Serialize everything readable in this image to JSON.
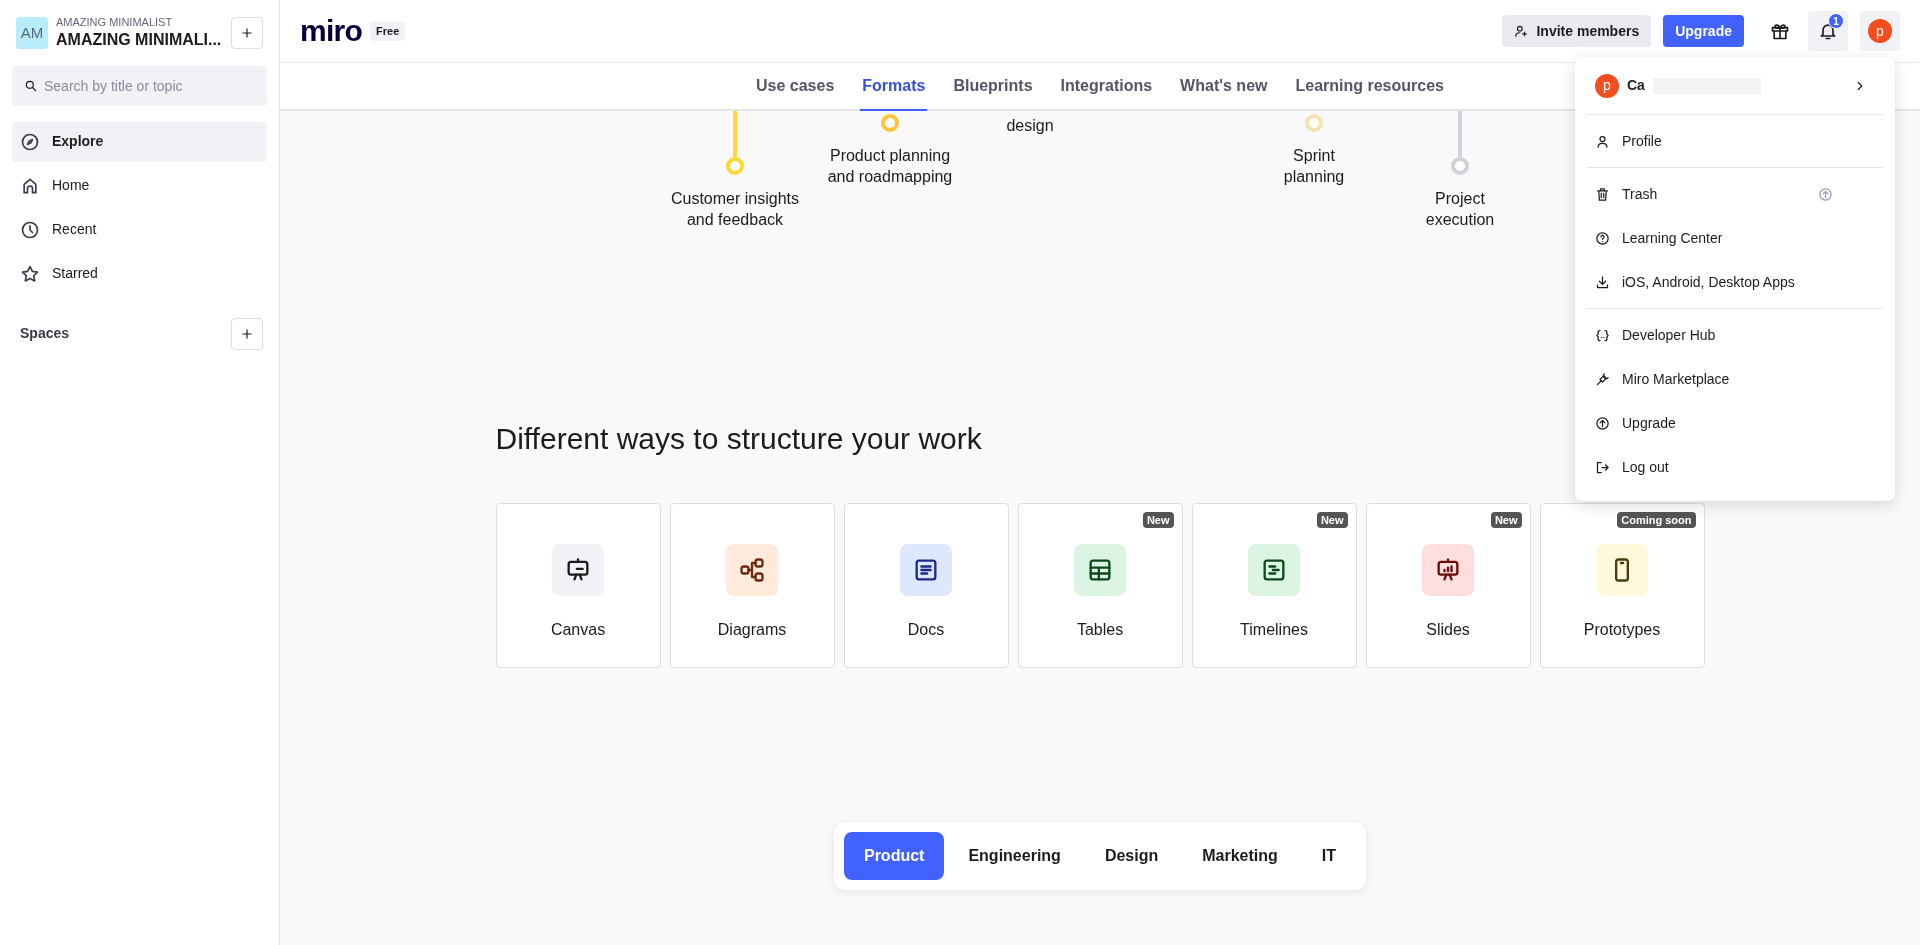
{
  "workspace": {
    "initials": "AM",
    "caption": "AMAZING MINIMALIST",
    "name": "AMAZING MINIMALI..."
  },
  "search": {
    "placeholder": "Search by title or topic"
  },
  "nav_items": [
    {
      "kind": "explore",
      "label": "Explore",
      "selected": true
    },
    {
      "kind": "home",
      "label": "Home",
      "selected": false
    },
    {
      "kind": "recent",
      "label": "Recent",
      "selected": false
    },
    {
      "kind": "starred",
      "label": "Starred",
      "selected": false
    }
  ],
  "spaces": {
    "label": "Spaces"
  },
  "header": {
    "logo": "miro",
    "plan": "Free",
    "invite": "Invite members",
    "upgrade": "Upgrade",
    "notification_count": "1",
    "avatar": "p"
  },
  "tabs": [
    {
      "label": "Use cases",
      "selected": false
    },
    {
      "label": "Formats",
      "selected": true
    },
    {
      "label": "Blueprints",
      "selected": false
    },
    {
      "label": "Integrations",
      "selected": false
    },
    {
      "label": "What's new",
      "selected": false
    },
    {
      "label": "Learning resources",
      "selected": false
    }
  ],
  "timeline": [
    {
      "kind": "low",
      "label": "Customer insights and feedback",
      "color": "#fdd835"
    },
    {
      "kind": "high",
      "label": "Product planning and roadmapping",
      "color": "#fbc43a"
    },
    {
      "kind": "text",
      "label": "design"
    },
    {
      "kind": "high",
      "label": "Sprint planning",
      "color": "#f3e3b0"
    },
    {
      "kind": "low",
      "label": "Project execution",
      "color": "#d3d0d8"
    }
  ],
  "section_title": "Different ways to structure your work",
  "formats": [
    {
      "kind": "canvas",
      "label": "Canvas"
    },
    {
      "kind": "diagrams",
      "label": "Diagrams"
    },
    {
      "kind": "docs",
      "label": "Docs"
    },
    {
      "kind": "tables",
      "label": "Tables",
      "badge": "New"
    },
    {
      "kind": "timelines",
      "label": "Timelines",
      "badge": "New"
    },
    {
      "kind": "slides",
      "label": "Slides",
      "badge": "New"
    },
    {
      "kind": "prototypes",
      "label": "Prototypes",
      "badge": "Coming soon"
    }
  ],
  "categories": [
    {
      "label": "Product",
      "selected": true
    },
    {
      "label": "Engineering",
      "selected": false
    },
    {
      "label": "Design",
      "selected": false
    },
    {
      "label": "Marketing",
      "selected": false
    },
    {
      "label": "IT",
      "selected": false
    }
  ],
  "account_menu": {
    "avatar": "p",
    "name": "Ca",
    "groups": [
      [
        {
          "kind": "profile",
          "label": "Profile"
        }
      ],
      [
        {
          "kind": "trash",
          "label": "Trash",
          "upgrade_hint": true
        },
        {
          "kind": "help",
          "label": "Learning Center"
        },
        {
          "kind": "download",
          "label": "iOS, Android, Desktop Apps"
        }
      ],
      [
        {
          "kind": "code",
          "label": "Developer Hub"
        },
        {
          "kind": "plug",
          "label": "Miro Marketplace"
        },
        {
          "kind": "upgrade",
          "label": "Upgrade"
        },
        {
          "kind": "logout",
          "label": "Log out"
        }
      ]
    ]
  }
}
